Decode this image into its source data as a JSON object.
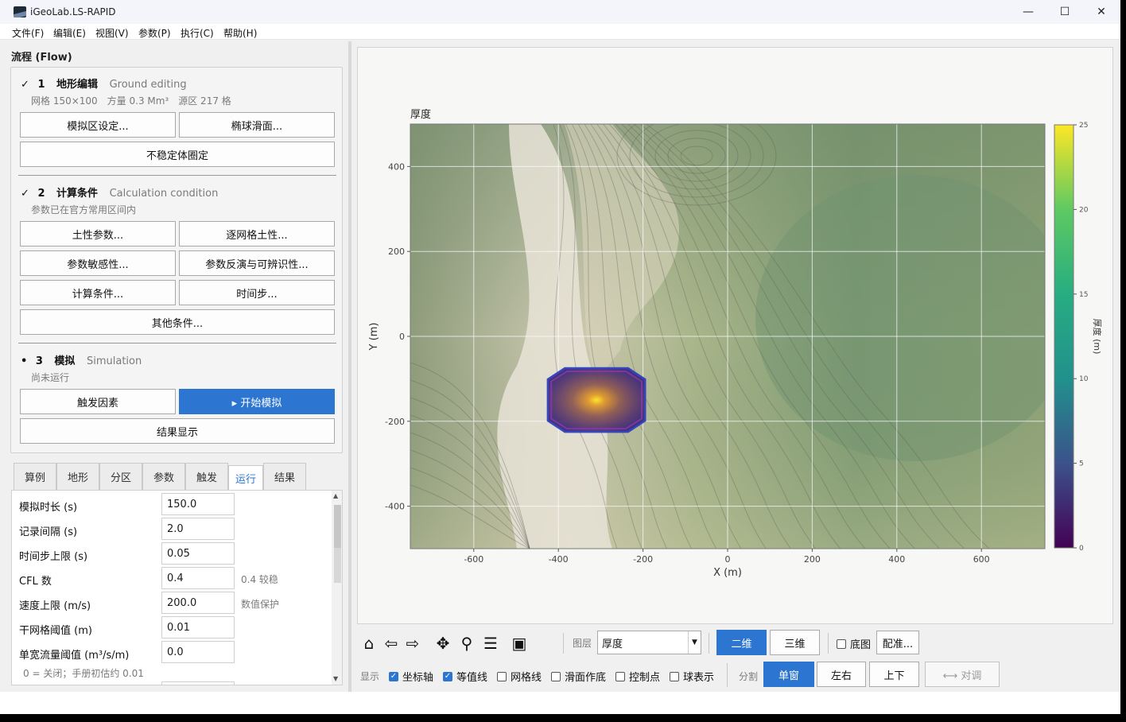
{
  "window": {
    "title": "iGeoLab.LS-RAPID",
    "minimize": "—",
    "maximize": "☐",
    "close": "✕"
  },
  "menu": [
    "文件(F)",
    "编辑(E)",
    "视图(V)",
    "参数(P)",
    "执行(C)",
    "帮助(H)"
  ],
  "flow": {
    "title": "流程 (Flow)",
    "step1": {
      "mark": "✓",
      "num": "1",
      "name": "地形编辑",
      "en": "Ground editing",
      "sub": "网格 150×100　方量 0.3 Mm³　源区 217 格",
      "btn_sim_area": "模拟区设定...",
      "btn_ellipsoid": "椭球滑面...",
      "btn_unstable": "不稳定体圈定"
    },
    "step2": {
      "mark": "✓",
      "num": "2",
      "name": "计算条件",
      "en": "Calculation condition",
      "sub": "参数已在官方常用区间内",
      "btn_soil": "土性参数...",
      "btn_cell_soil": "逐网格土性...",
      "btn_sensitivity": "参数敏感性...",
      "btn_inversion": "参数反演与可辨识性...",
      "btn_calc": "计算条件...",
      "btn_timestep": "时间步...",
      "btn_other": "其他条件..."
    },
    "step3": {
      "mark": "•",
      "num": "3",
      "name": "模拟",
      "en": "Simulation",
      "sub": "尚未运行",
      "btn_trigger": "触发因素",
      "btn_start": "▸ 开始模拟",
      "btn_result": "结果显示"
    }
  },
  "tabs": [
    "算例",
    "地形",
    "分区",
    "参数",
    "触发",
    "运行",
    "结果"
  ],
  "active_tab": "运行",
  "params": [
    {
      "label": "模拟时长 (s)",
      "value": "150.0",
      "note": ""
    },
    {
      "label": "记录间隔 (s)",
      "value": "2.0",
      "note": ""
    },
    {
      "label": "时间步上限 (s)",
      "value": "0.05",
      "note": ""
    },
    {
      "label": "CFL 数",
      "value": "0.4",
      "note": "0.4 较稳"
    },
    {
      "label": "速度上限 (m/s)",
      "value": "200.0",
      "note": "数值保护"
    },
    {
      "label": "干网格阈值 (m)",
      "value": "0.01",
      "note": ""
    },
    {
      "label": "单宽流量阈值 (m³/s/m)",
      "value": "0.0",
      "note": ""
    }
  ],
  "params_hint": "0 = 关闭；手册初估约 0.01",
  "chart_data": {
    "type": "heatmap",
    "title": "厚度",
    "xlabel": "X (m)",
    "ylabel": "Y (m)",
    "xlim": [
      -750,
      750
    ],
    "ylim": [
      -500,
      500
    ],
    "xticks": [
      -600,
      -400,
      -200,
      0,
      200,
      400,
      600
    ],
    "yticks": [
      -400,
      -200,
      0,
      200,
      400
    ],
    "colorbar": {
      "label": "厚度 (m)",
      "range": [
        0,
        25
      ],
      "ticks": [
        0,
        5,
        10,
        15,
        20,
        25
      ],
      "colormap": "viridis"
    },
    "source_area": {
      "center_x": -310,
      "center_y": -150,
      "half_width_x": 115,
      "half_width_y": 75,
      "peak_thickness": 25
    },
    "grid": true,
    "background": "hillshaded terrain with contour lines"
  },
  "toolbar": {
    "icons": [
      "home-icon",
      "back-icon",
      "forward-icon",
      "pan-icon",
      "zoom-icon",
      "settings-icon",
      "save-icon"
    ],
    "layer_label": "图层",
    "layer_value": "厚度",
    "btn_2d": "二维",
    "btn_3d": "三维",
    "basemap_label": "底图",
    "btn_register": "配准..."
  },
  "display_bar": {
    "display_label": "显示",
    "options": [
      {
        "label": "坐标轴",
        "checked": true
      },
      {
        "label": "等值线",
        "checked": true
      },
      {
        "label": "网格线",
        "checked": false
      },
      {
        "label": "滑面作底",
        "checked": false
      },
      {
        "label": "控制点",
        "checked": false
      },
      {
        "label": "球表示",
        "checked": false
      }
    ],
    "split_label": "分割",
    "btn_single": "单窗",
    "btn_lr": "左右",
    "btn_ud": "上下",
    "btn_compare": "⟷ 对调"
  },
  "colors": {
    "accent": "#2c76d2",
    "panel": "#f4f4f4"
  }
}
